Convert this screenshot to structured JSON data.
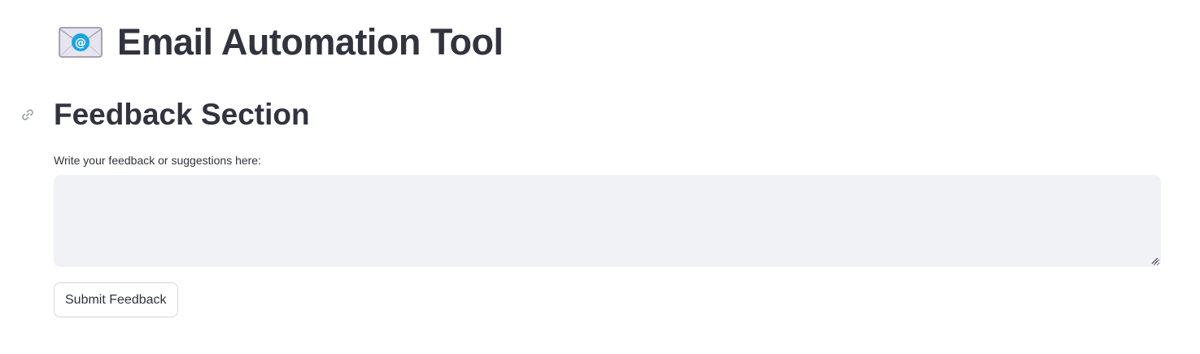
{
  "header": {
    "icon": "envelope-with-at-icon",
    "title": "Email Automation Tool"
  },
  "section": {
    "anchor_icon": "link-icon",
    "title": "Feedback Section"
  },
  "feedback": {
    "label": "Write your feedback or suggestions here:",
    "value": "",
    "placeholder": ""
  },
  "actions": {
    "submit_label": "Submit Feedback"
  },
  "colors": {
    "text": "#31333f",
    "input_bg": "#f0f2f6",
    "button_border": "#d6d6d9",
    "at_badge": "#1aa3e8"
  }
}
